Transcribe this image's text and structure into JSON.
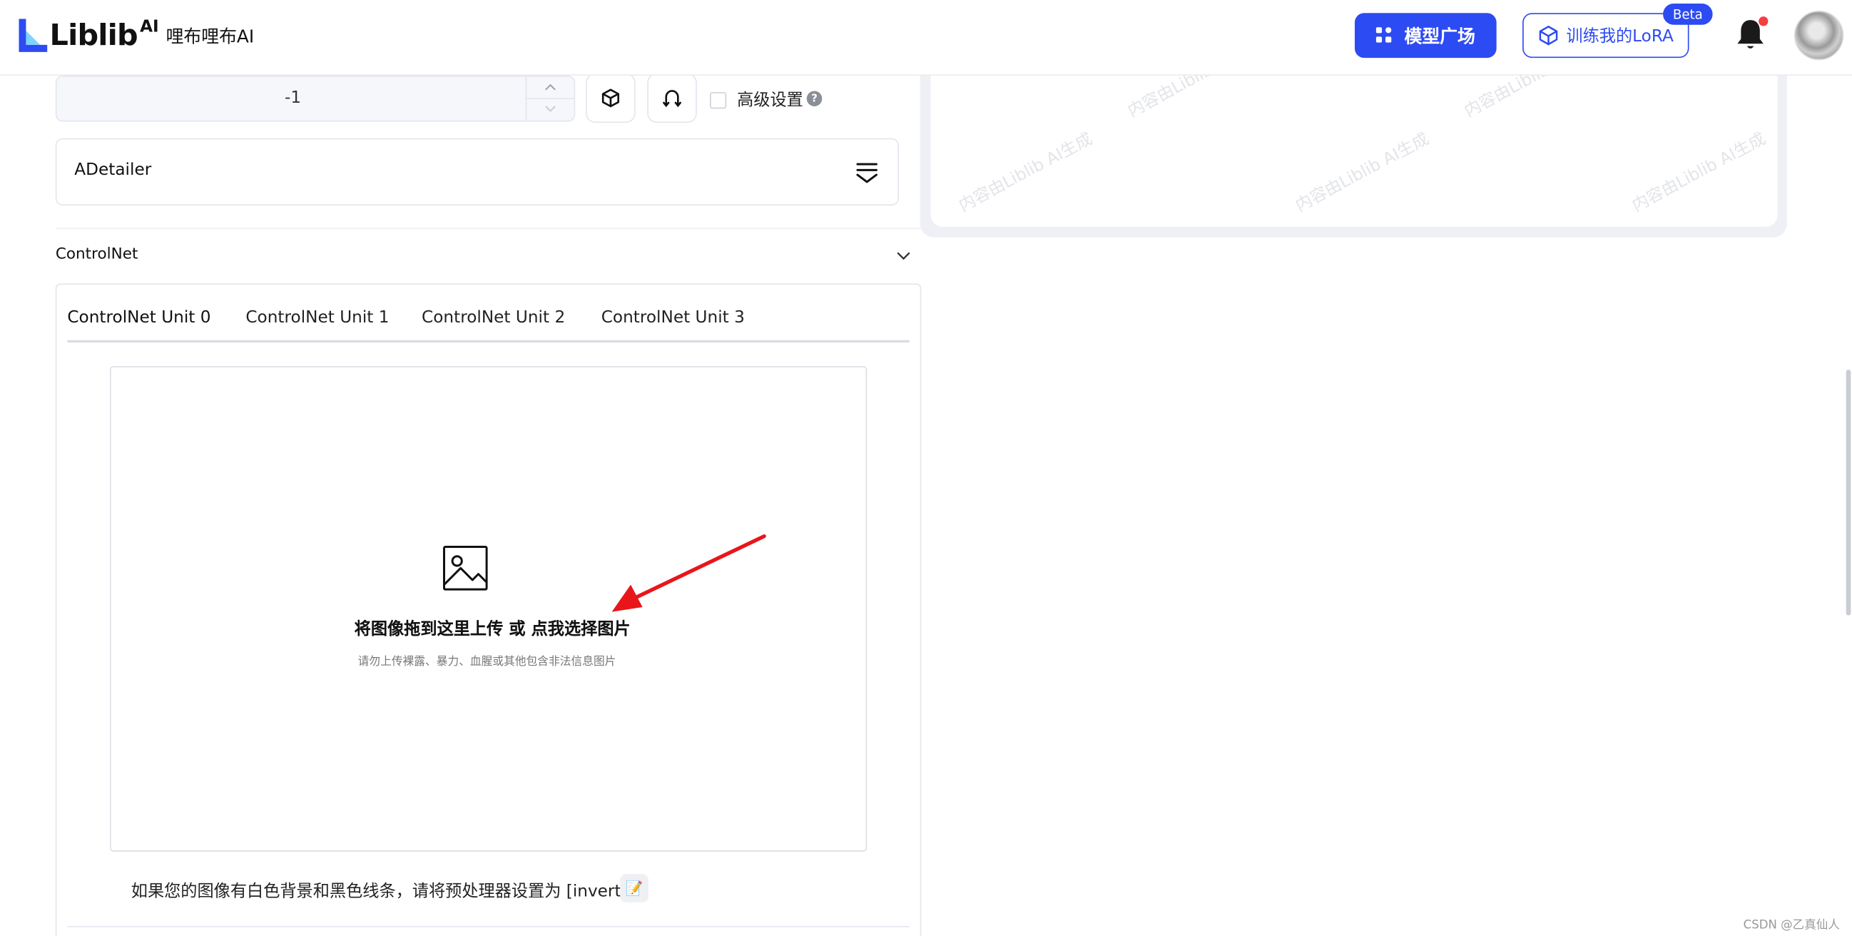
{
  "brand": {
    "name": "Liblib",
    "ai_suffix": "AI",
    "cn_name": "哩布哩布AI"
  },
  "header": {
    "models_button": "模型广场",
    "train_lora_button": "训练我的LoRA",
    "beta_badge": "Beta"
  },
  "seed": {
    "value": "-1"
  },
  "advanced": {
    "label": "高级设置",
    "help": "?"
  },
  "adetailer": {
    "label": "ADetailer"
  },
  "controlnet": {
    "title": "ControlNet",
    "tabs": [
      "ControlNet Unit 0",
      "ControlNet Unit 1",
      "ControlNet Unit 2",
      "ControlNet Unit 3"
    ],
    "upload_main": "将图像拖到这里上传 或 点我选择图片",
    "upload_sub": "请勿上传裸露、暴力、血腥或其他包含非法信息图片",
    "invert_hint": "如果您的图像有白色背景和黑色线条，请将预处理器设置为 [invert].",
    "hint_icon": "📝"
  },
  "preview": {
    "watermark": "内容由Liblib AI生成"
  },
  "credit": "CSDN @乙真仙人",
  "colors": {
    "accent": "#2d4bf2",
    "notify": "#f43f3f",
    "arrow": "#e8161b"
  }
}
